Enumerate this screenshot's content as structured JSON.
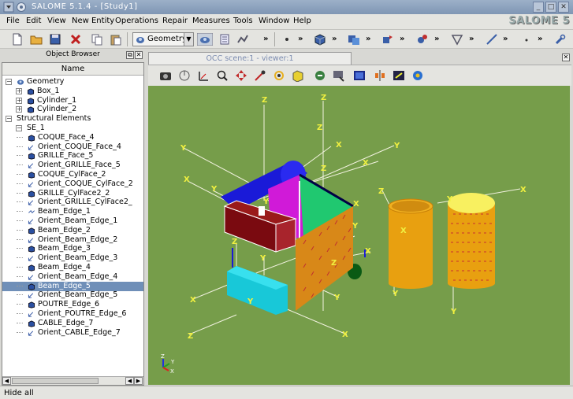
{
  "window": {
    "title": "SALOME 5.1.4 - [Study1]",
    "controls": [
      "minimize-icon",
      "maximize-icon",
      "close-icon"
    ]
  },
  "menubar": {
    "items": [
      "File",
      "Edit",
      "View",
      "New Entity",
      "Operations",
      "Repair",
      "Measures",
      "Tools",
      "Window",
      "Help"
    ],
    "logo": "SALOME 5"
  },
  "toolbar": {
    "module_combo": "Geometry",
    "chevron": "»"
  },
  "object_browser": {
    "title": "Object Browser",
    "column_header": "Name",
    "tree": [
      {
        "label": "Geometry",
        "indent": 0,
        "expander": "−",
        "icon": "geometry-icon"
      },
      {
        "label": "Box_1",
        "indent": 1,
        "expander": "+",
        "icon": "solid-icon"
      },
      {
        "label": "Cylinder_1",
        "indent": 1,
        "expander": "+",
        "icon": "solid-icon"
      },
      {
        "label": "Cylinder_2",
        "indent": 1,
        "expander": "+",
        "icon": "solid-icon"
      },
      {
        "label": "Structural Elements",
        "indent": 0,
        "expander": "−",
        "icon": ""
      },
      {
        "label": "SE_1",
        "indent": 1,
        "expander": "−",
        "icon": ""
      },
      {
        "label": "COQUE_Face_4",
        "indent": 2,
        "expander": "",
        "icon": "solid-icon"
      },
      {
        "label": "Orient_COQUE_Face_4",
        "indent": 2,
        "expander": "",
        "icon": "orient-icon"
      },
      {
        "label": "GRILLE_Face_5",
        "indent": 2,
        "expander": "",
        "icon": "solid-icon"
      },
      {
        "label": "Orient_GRILLE_Face_5",
        "indent": 2,
        "expander": "",
        "icon": "orient-icon"
      },
      {
        "label": "COQUE_CylFace_2",
        "indent": 2,
        "expander": "",
        "icon": "solid-icon"
      },
      {
        "label": "Orient_COQUE_CylFace_2",
        "indent": 2,
        "expander": "",
        "icon": "orient-icon"
      },
      {
        "label": "GRILLE_CylFace2_2",
        "indent": 2,
        "expander": "",
        "icon": "solid-icon"
      },
      {
        "label": "Orient_GRILLE_CylFace2_",
        "indent": 2,
        "expander": "",
        "icon": "orient-icon"
      },
      {
        "label": "Beam_Edge_1",
        "indent": 2,
        "expander": "",
        "icon": "beam-icon"
      },
      {
        "label": "Orient_Beam_Edge_1",
        "indent": 2,
        "expander": "",
        "icon": "orient-icon"
      },
      {
        "label": "Beam_Edge_2",
        "indent": 2,
        "expander": "",
        "icon": "solid-icon"
      },
      {
        "label": "Orient_Beam_Edge_2",
        "indent": 2,
        "expander": "",
        "icon": "orient-icon"
      },
      {
        "label": "Beam_Edge_3",
        "indent": 2,
        "expander": "",
        "icon": "solid-icon"
      },
      {
        "label": "Orient_Beam_Edge_3",
        "indent": 2,
        "expander": "",
        "icon": "orient-icon"
      },
      {
        "label": "Beam_Edge_4",
        "indent": 2,
        "expander": "",
        "icon": "solid-icon"
      },
      {
        "label": "Orient_Beam_Edge_4",
        "indent": 2,
        "expander": "",
        "icon": "orient-icon"
      },
      {
        "label": "Beam_Edge_5",
        "indent": 2,
        "expander": "",
        "icon": "solid-icon",
        "selected": true
      },
      {
        "label": "Orient_Beam_Edge_5",
        "indent": 2,
        "expander": "",
        "icon": "orient-icon"
      },
      {
        "label": "POUTRE_Edge_6",
        "indent": 2,
        "expander": "",
        "icon": "solid-icon"
      },
      {
        "label": "Orient_POUTRE_Edge_6",
        "indent": 2,
        "expander": "",
        "icon": "orient-icon"
      },
      {
        "label": "CABLE_Edge_7",
        "indent": 2,
        "expander": "",
        "icon": "solid-icon"
      },
      {
        "label": "Orient_CABLE_Edge_7",
        "indent": 2,
        "expander": "",
        "icon": "orient-icon"
      }
    ]
  },
  "viewer": {
    "tab_title": "OCC scene:1 - viewer:1",
    "background": "#769d4a",
    "axis_letters": {
      "x": "X",
      "y": "Y",
      "z": "Z"
    },
    "trihedron": {
      "x": "X",
      "y": "Y",
      "z": "Z"
    }
  },
  "statusbar": {
    "text": "Hide all"
  }
}
